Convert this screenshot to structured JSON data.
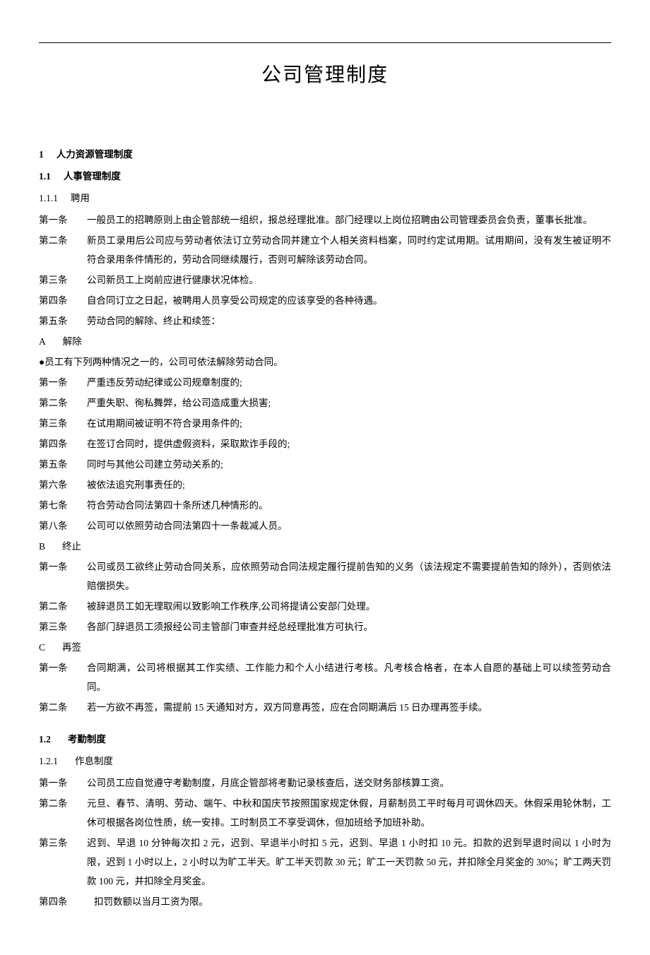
{
  "title": "公司管理制度",
  "s1": {
    "num": "1",
    "label": "人力资源管理制度"
  },
  "s11": {
    "num": "1.1",
    "label": "人事管理制度"
  },
  "s111": {
    "num": "1.1.1",
    "label": "聘用"
  },
  "hire": {
    "a1_label": "第一条",
    "a1": "一般员工的招聘原则上由企管部统一组织，报总经理批准。部门经理以上岗位招聘由公司管理委员会负责，董事长批准。",
    "a2_label": "第二条",
    "a2": "新员工录用后公司应与劳动者依法订立劳动合同并建立个人相关资料档案，同时约定试用期。试用期间，没有发生被证明不符合录用条件情形的，劳动合同继续履行，否则可解除该劳动合同。",
    "a3_label": "第三条",
    "a3": "公司新员工上岗前应进行健康状况体检。",
    "a4_label": "第四条",
    "a4": "自合同订立之日起，被聘用人员享受公司规定的应该享受的各种待遇。",
    "a5_label": "第五条",
    "a5": "劳动合同的解除、终止和续签："
  },
  "secA": {
    "label": "A",
    "title": "解除",
    "bullet": "●员工有下列两种情况之一的，公司可依法解除劳动合同。",
    "a1_label": "第一条",
    "a1": "严重违反劳动纪律或公司规章制度的;",
    "a2_label": "第二条",
    "a2": "严重失职、徇私舞弊，给公司造成重大损害;",
    "a3_label": "第三条",
    "a3": "在试用期间被证明不符合录用条件的;",
    "a4_label": "第四条",
    "a4": "在签订合同时，提供虚假资料，采取欺诈手段的;",
    "a5_label": "第五条",
    "a5": "同时与其他公司建立劳动关系的;",
    "a6_label": "第六条",
    "a6": "被依法追究刑事责任的;",
    "a7_label": "第七条",
    "a7": "符合劳动合同法第四十条所述几种情形的。",
    "a8_label": "第八条",
    "a8": "公司可以依照劳动合同法第四十一条裁减人员。"
  },
  "secB": {
    "label": "B",
    "title": "终止",
    "a1_label": "第一条",
    "a1": "公司或员工欲终止劳动合同关系，应依照劳动合同法规定履行提前告知的义务（该法规定不需要提前告知的除外），否则依法赔偿损失。",
    "a2_label": "第二条",
    "a2": "被辞退员工如无理取闹以致影响工作秩序,公司将提请公安部门处理。",
    "a3_label": "第三条",
    "a3": "各部门辞退员工须报经公司主管部门审查并经总经理批准方可执行。"
  },
  "secC": {
    "label": "C",
    "title": "再签",
    "a1_label": "第一条",
    "a1": "合同期满，公司将根据其工作实绩、工作能力和个人小结进行考核。凡考核合格者，在本人自愿的基础上可以续签劳动合同。",
    "a2_label": "第二条",
    "a2": "若一方欲不再签，需提前 15 天通知对方，双方同意再签，应在合同期满后 15 日办理再签手续。"
  },
  "s12": {
    "num": "1.2",
    "label": "考勤制度"
  },
  "s121": {
    "num": "1.2.1",
    "label": "作息制度"
  },
  "attend": {
    "a1_label": "第一条",
    "a1": "公司员工应自觉遵守考勤制度，月底企管部将考勤记录核查后，送交财务部核算工资。",
    "a2_label": "第二条",
    "a2": "元旦、春节、清明、劳动、端午、中秋和国庆节按照国家规定休假，月薪制员工平时每月可调休四天。休假采用轮休制，工休可根据各岗位性质，统一安排。工时制员工不享受调休，但加班给予加班补助。",
    "a3_label": "第三条",
    "a3": "迟到、早退 10 分钟每次扣 2 元，迟到、早退半小时扣 5 元，迟到、早退 1 小时扣 10 元。扣款的迟到早退时间以 1 小时为限，迟到 1 小时以上，2 小时以为旷工半天。旷工半天罚款 30 元；旷工一天罚款 50 元，并扣除全月奖金的 30%；旷工两天罚款 100 元，并扣除全月奖金。",
    "a4_label": "第四条",
    "a4": "扣罚数额以当月工资为限。"
  }
}
